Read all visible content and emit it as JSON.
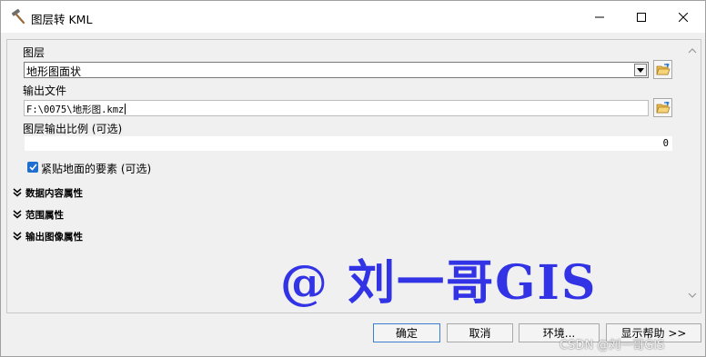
{
  "window": {
    "title": "图层转 KML",
    "icon": "tool-hammer-icon"
  },
  "form": {
    "layer_label": "图层",
    "layer_value": "地形图面状",
    "output_label": "输出文件",
    "output_value": "F:\\0075\\地形图.kmz",
    "scale_label": "图层输出比例 (可选)",
    "scale_value": "0",
    "clamp_label": "紧贴地面的要素 (可选)",
    "clamp_checked": true
  },
  "sections": [
    {
      "label": "数据内容属性"
    },
    {
      "label": "范围属性"
    },
    {
      "label": "输出图像属性"
    }
  ],
  "watermark": "@ 刘一哥GIS",
  "buttons": {
    "ok": "确定",
    "cancel": "取消",
    "environments": "环境...",
    "help": "显示帮助 >>"
  },
  "overlay_watermark": "CSDN @刘一哥GIS",
  "colors": {
    "accent": "#1e6fd0",
    "watermark": "#3333e6"
  }
}
